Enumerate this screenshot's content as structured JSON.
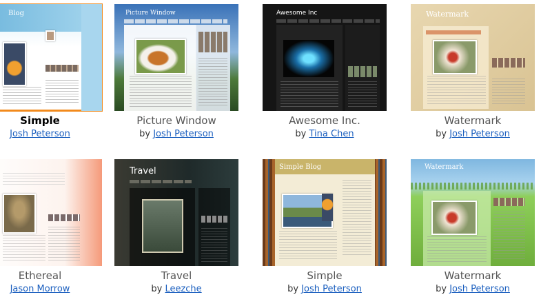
{
  "templates": [
    {
      "name": "Simple",
      "by": "",
      "author": "Josh Peterson",
      "thumb_title": "Blog",
      "selected": true
    },
    {
      "name": "Picture Window",
      "by": "by",
      "author": "Josh Peterson",
      "thumb_title": "Picture Window",
      "selected": false
    },
    {
      "name": "Awesome Inc.",
      "by": "by",
      "author": "Tina Chen",
      "thumb_title": "Awesome Inc",
      "selected": false
    },
    {
      "name": "Watermark",
      "by": "by",
      "author": "Josh Peterson",
      "thumb_title": "Watermark",
      "selected": false
    },
    {
      "name": "Ethereal",
      "by": "",
      "author": "Jason Morrow",
      "thumb_title": "",
      "selected": false
    },
    {
      "name": "Travel",
      "by": "by",
      "author": "Leezche",
      "thumb_title": "Travel",
      "selected": false
    },
    {
      "name": "Simple",
      "by": "by",
      "author": "Josh Peterson",
      "thumb_title": "Simple Blog",
      "selected": false
    },
    {
      "name": "Watermark",
      "by": "by",
      "author": "Josh Peterson",
      "thumb_title": "Watermark",
      "selected": false
    }
  ]
}
